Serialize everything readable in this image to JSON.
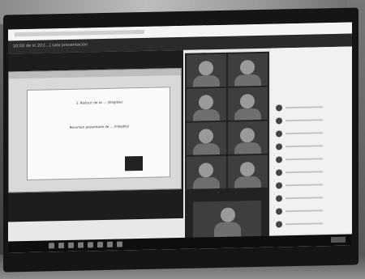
{
  "meeting": {
    "window_title": "10:00 de lo 20:[...] sala presentación"
  },
  "slide": {
    "line1": "1. Reducir de as ... (illegible)",
    "line2": "Resumen presentado de ... (illegible)"
  },
  "participants_count_visible": 10
}
